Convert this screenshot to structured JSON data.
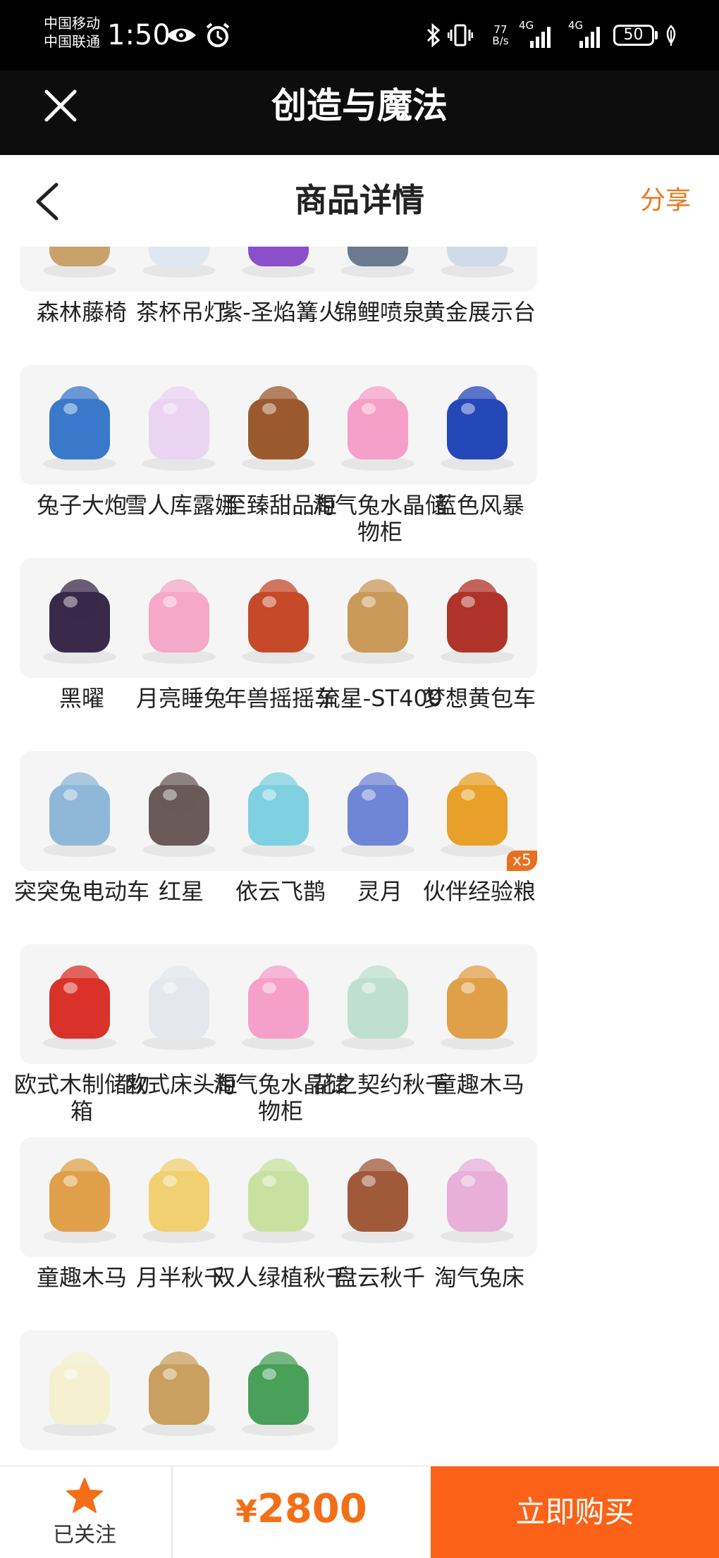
{
  "status_bar": {
    "carrier1": "中国移动",
    "carrier2": "中国联通",
    "time": "1:50",
    "net_speed_value": "77",
    "net_speed_unit": "B/s",
    "sig1_label": "4G",
    "sig2_label": "4G",
    "battery": "50"
  },
  "title_bar": {
    "title": "创造与魔法"
  },
  "nav": {
    "title": "商品详情",
    "share": "分享"
  },
  "items": [
    {
      "name": "森林藤椅",
      "icon": "rattan-chair"
    },
    {
      "name": "茶杯吊灯",
      "icon": "teacup-chandelier"
    },
    {
      "name": "紫-圣焰篝火",
      "icon": "purple-bonfire"
    },
    {
      "name": "锦鲤喷泉",
      "icon": "koi-fountain"
    },
    {
      "name": "黄金展示台",
      "icon": "golden-display-stand"
    },
    {
      "name": "兔子大炮",
      "icon": "rabbit-cannon"
    },
    {
      "name": "雪人库露娜",
      "icon": "snowman-luna"
    },
    {
      "name": "至臻甜品柜",
      "icon": "dessert-cabinet"
    },
    {
      "name": "淘气兔水晶储物柜",
      "icon": "bunny-wardrobe"
    },
    {
      "name": "蓝色风暴",
      "icon": "blue-race-car"
    },
    {
      "name": "黑曜",
      "icon": "black-car"
    },
    {
      "name": "月亮睡兔",
      "icon": "moon-sleeping-bunny"
    },
    {
      "name": "年兽摇摇车",
      "icon": "nian-rocking-car"
    },
    {
      "name": "流星-ST400",
      "icon": "meteor-jet"
    },
    {
      "name": "梦想黄包车",
      "icon": "rickshaw"
    },
    {
      "name": "突突兔电动车",
      "icon": "bunny-scooter"
    },
    {
      "name": "红星",
      "icon": "motorcycle"
    },
    {
      "name": "依云飞鹊",
      "icon": "cloud-magpie"
    },
    {
      "name": "灵月",
      "icon": "crescent-moon"
    },
    {
      "name": "伙伴经验粮",
      "icon": "exp-food-bag",
      "badge": "x5"
    },
    {
      "name": "欧式木制储物箱",
      "icon": "wooden-storage-box"
    },
    {
      "name": "欧式床头柜",
      "icon": "nightstand"
    },
    {
      "name": "淘气兔水晶储物柜",
      "icon": "bunny-wardrobe"
    },
    {
      "name": "花之契约秋千",
      "icon": "flower-swing"
    },
    {
      "name": "童趣木马",
      "icon": "rocking-horse"
    },
    {
      "name": "童趣木马",
      "icon": "rocking-horse"
    },
    {
      "name": "月半秋千",
      "icon": "half-moon-swing"
    },
    {
      "name": "双人绿植秋千",
      "icon": "double-swing"
    },
    {
      "name": "盘云秋千",
      "icon": "cloud-swing"
    },
    {
      "name": "淘气兔床",
      "icon": "bunny-bed"
    },
    {
      "name": "",
      "icon": "flower-lamp"
    },
    {
      "name": "",
      "icon": "nest-bowl"
    },
    {
      "name": "",
      "icon": "green-vase-plant"
    }
  ],
  "bottom": {
    "follow_label": "已关注",
    "currency": "¥",
    "price": "2800",
    "buy_label": "立即购买"
  },
  "colors": {
    "accent": "#fb6217",
    "price": "#f36f17",
    "share": "#e8781d",
    "star": "#f36f17"
  }
}
